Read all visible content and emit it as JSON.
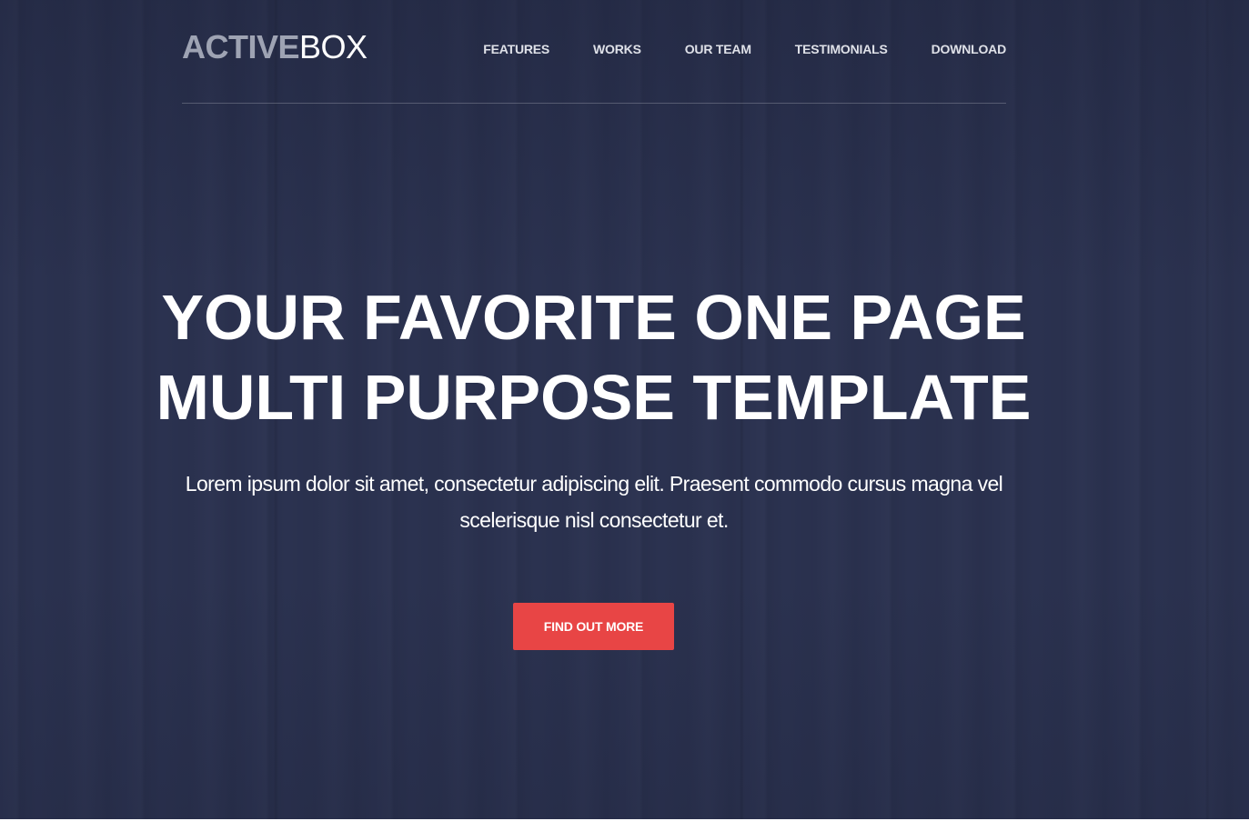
{
  "brand": {
    "logo_strong": "ACTIVE",
    "logo_light": "BOX"
  },
  "nav": {
    "items": [
      {
        "label": "FEATURES"
      },
      {
        "label": "WORKS"
      },
      {
        "label": "OUR TEAM"
      },
      {
        "label": "TESTIMONIALS"
      },
      {
        "label": "DOWNLOAD"
      }
    ]
  },
  "hero": {
    "headline_line1": "YOUR FAVORITE ONE PAGE",
    "headline_line2": "MULTI PURPOSE TEMPLATE",
    "subtext": "Lorem ipsum dolor sit amet, consectetur adipiscing elit. Praesent commodo cursus magna vel scelerisque nisl consectetur et.",
    "cta_label": "FIND OUT MORE"
  },
  "colors": {
    "background": "#2b3250",
    "accent": "#e84545",
    "logo_strong": "#9ea3b3",
    "text": "#ffffff"
  }
}
